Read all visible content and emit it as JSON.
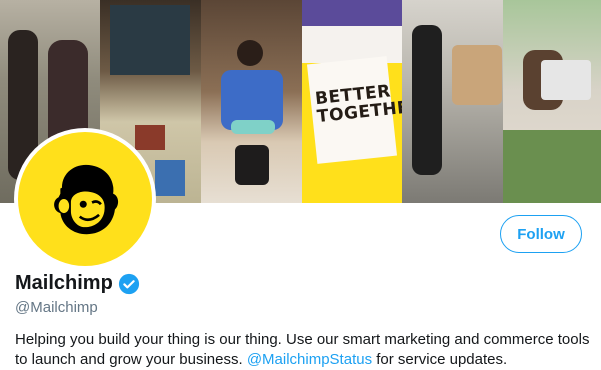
{
  "banner": {
    "panel_text": "BETTER TOGETHER",
    "colors": {
      "yellow": "#ffe01b",
      "purple": "#5b4b9a"
    }
  },
  "profile": {
    "avatar_icon": "mailchimp-freddie-logo",
    "display_name": "Mailchimp",
    "verified_icon": "verified-badge-icon",
    "handle": "@Mailchimp",
    "bio_part1": "Helping you build your thing is our thing. Use our smart marketing and commerce tools to launch and grow your business. ",
    "bio_mention": "@MailchimpStatus",
    "bio_part2": " for service updates."
  },
  "actions": {
    "follow_label": "Follow"
  },
  "colors": {
    "accent": "#1da1f2",
    "text": "#14171a",
    "muted": "#657786",
    "brand_yellow": "#ffe01b"
  }
}
